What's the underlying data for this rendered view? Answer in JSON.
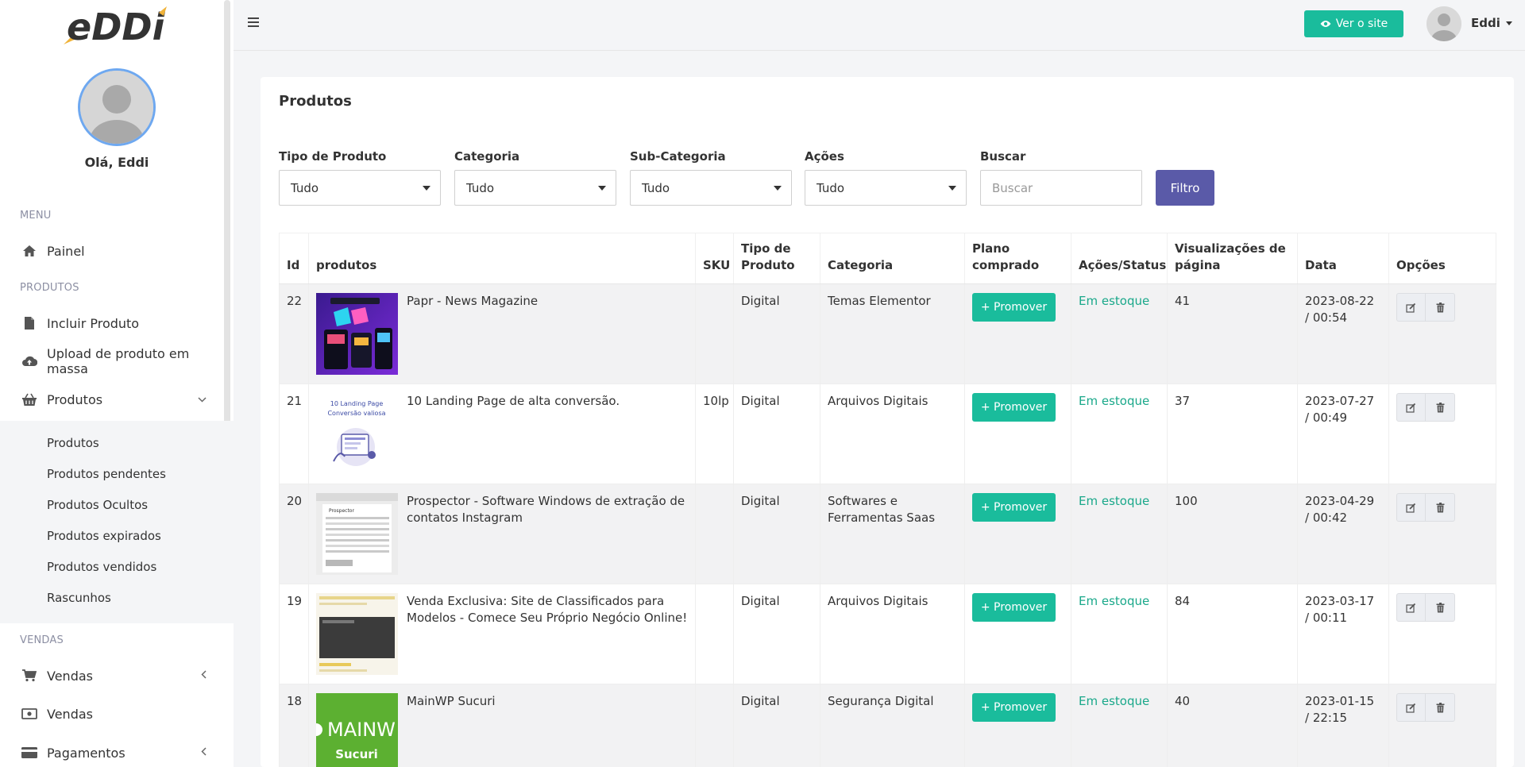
{
  "brand": {
    "logo_text": "eDDi"
  },
  "sidebar": {
    "greeting": "Olá, Eddi",
    "menu_header": "MENU",
    "painel": "Painel",
    "produtos_header": "PRODUTOS",
    "incluir_produto": "Incluir Produto",
    "upload_massa": "Upload de produto em massa",
    "produtos": "Produtos",
    "submenu": [
      "Produtos",
      "Produtos pendentes",
      "Produtos Ocultos",
      "Produtos expirados",
      "Produtos vendidos",
      "Rascunhos"
    ],
    "vendas_header": "VENDAS",
    "vendas_group": "Vendas",
    "vendas": "Vendas",
    "pagamentos": "Pagamentos"
  },
  "topbar": {
    "ver_site": "Ver o site",
    "user_name": "Eddi"
  },
  "page": {
    "title": "Produtos",
    "filters": {
      "tipo_label": "Tipo de Produto",
      "tipo_value": "Tudo",
      "categoria_label": "Categoria",
      "categoria_value": "Tudo",
      "subcategoria_label": "Sub-Categoria",
      "subcategoria_value": "Tudo",
      "acoes_label": "Ações",
      "acoes_value": "Tudo",
      "buscar_label": "Buscar",
      "buscar_placeholder": "Buscar",
      "filtro_button": "Filtro"
    },
    "table": {
      "headers": [
        "Id",
        "produtos",
        "SKU",
        "Tipo de Produto",
        "Categoria",
        "Plano comprado",
        "Ações/Status",
        "Visualizações de página",
        "Data",
        "Opções"
      ],
      "promote_label": "+ Promover",
      "rows": [
        {
          "id": "22",
          "name": "Papr - News Magazine",
          "sku": "",
          "tipo": "Digital",
          "categoria": "Temas Elementor",
          "status": "Em estoque",
          "views": "41",
          "data": "2023-08-22 / 00:54"
        },
        {
          "id": "21",
          "name": "10 Landing Page de alta conversão.",
          "sku": "10lp",
          "tipo": "Digital",
          "categoria": "Arquivos Digitais",
          "status": "Em estoque",
          "views": "37",
          "data": "2023-07-27 / 00:49"
        },
        {
          "id": "20",
          "name": "Prospector - Software Windows de extração de contatos Instagram",
          "sku": "",
          "tipo": "Digital",
          "categoria": "Softwares e Ferramentas Saas",
          "status": "Em estoque",
          "views": "100",
          "data": "2023-04-29 / 00:42"
        },
        {
          "id": "19",
          "name": "Venda Exclusiva: Site de Classificados para Modelos - Comece Seu Próprio Negócio Online!",
          "sku": "",
          "tipo": "Digital",
          "categoria": "Arquivos Digitais",
          "status": "Em estoque",
          "views": "84",
          "data": "2023-03-17 / 00:11"
        },
        {
          "id": "18",
          "name": "MainWP Sucuri",
          "sku": "",
          "tipo": "Digital",
          "categoria": "Segurança Digital",
          "status": "Em estoque",
          "views": "40",
          "data": "2023-01-15 / 22:15"
        }
      ],
      "thumb_texts": {
        "landing_line1": "10 Landing Page",
        "landing_line2": "Conversão valiosa",
        "prospector": "Prospector",
        "mainwp": "MAINW",
        "sucuri": "Sucuri"
      }
    }
  },
  "colors": {
    "accent": "#1abc9c",
    "filter_button": "#5a5aa8",
    "status": "#1aa88a"
  }
}
